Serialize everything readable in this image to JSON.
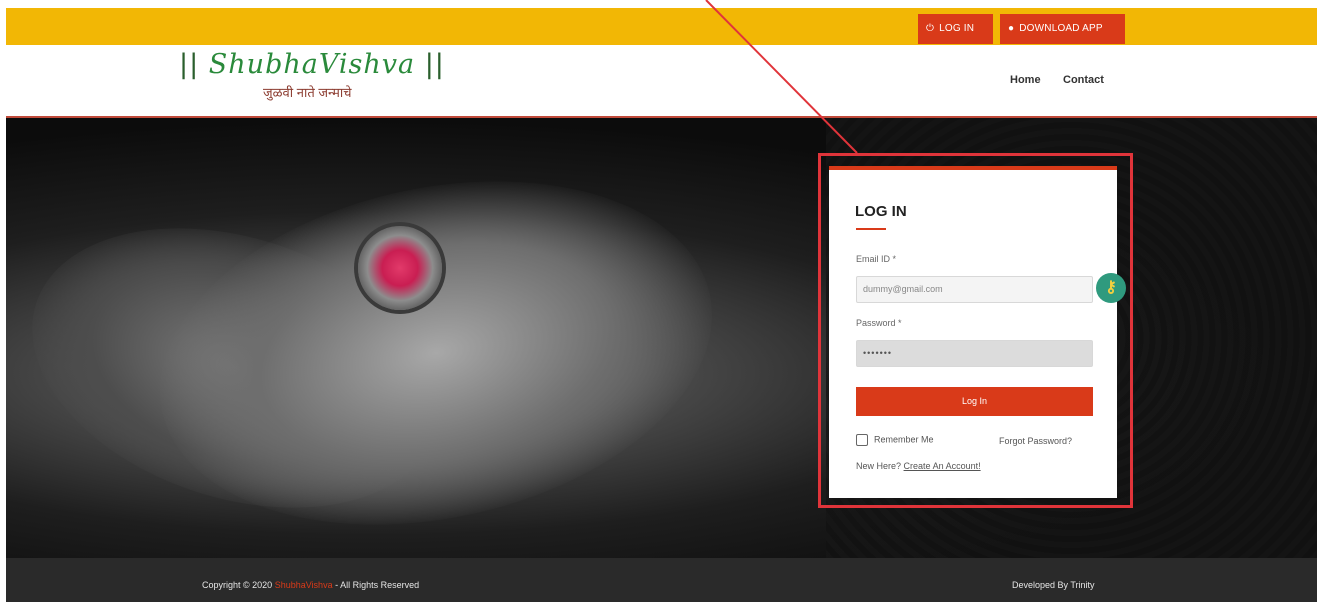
{
  "topbar": {
    "login_label": "LOG IN",
    "download_label": "DOWNLOAD APP",
    "accent_color": "#f2b705",
    "button_color": "#d93a19",
    "login_icon": "power-icon",
    "download_icon": "dot-icon"
  },
  "header": {
    "logo_main": "ShubhaVishva",
    "logo_bars_left": "||",
    "logo_bars_right": "||",
    "logo_tagline": "जुळवी नाते जन्माचे",
    "nav": {
      "home": "Home",
      "contact": "Contact"
    }
  },
  "login": {
    "title": "LOG IN",
    "email_label": "Email ID *",
    "email_value": "dummy@gmail.com",
    "password_label": "Password *",
    "password_value": "•••••••",
    "submit_label": "Log In",
    "remember_label": "Remember Me",
    "remember_checked": false,
    "forgot_label": "Forgot Password?",
    "new_here_text": "New Here?",
    "create_account_label": "Create An Account!",
    "key_icon": "key-icon"
  },
  "annotation": {
    "color": "#e0343a"
  },
  "footer": {
    "copyright_prefix": "Copyright © 2020",
    "brand_text": "ShubhaVishva",
    "copyright_suffix": "- All Rights Reserved",
    "developed_by": "Developed By Trinity"
  }
}
